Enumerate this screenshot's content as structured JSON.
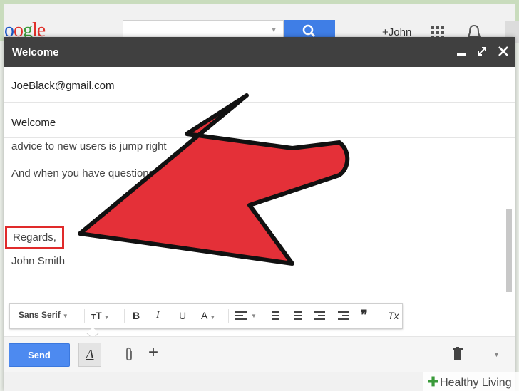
{
  "app": {
    "logo_text": "Google",
    "account": "+John",
    "colors": {
      "header": "#404040",
      "send": "#4d8af0",
      "search": "#3f7ee6",
      "arrow": "#e43038",
      "highlight": "#e02a2a"
    }
  },
  "compose": {
    "title": "Welcome",
    "to": "JoeBlack@gmail.com",
    "subject": "Welcome",
    "body": {
      "line1": "advice to new users is jump right",
      "line2": "And when you have questions",
      "regards": "Regards,",
      "signature": "John Smith"
    },
    "header_icons": [
      "minimize-icon",
      "popout-icon",
      "close-icon"
    ]
  },
  "formatting": {
    "font": "Sans Serif",
    "icons": [
      "text-size-icon",
      "bold-icon",
      "italic-icon",
      "underline-icon",
      "text-color-icon",
      "align-icon",
      "numbered-list-icon",
      "bulleted-list-icon",
      "indent-less-icon",
      "indent-more-icon",
      "quote-icon",
      "remove-formatting-icon"
    ],
    "bold": "B",
    "italic": "I",
    "underline": "U",
    "text_color": "A",
    "clear": "Tx"
  },
  "toolbar": {
    "send_label": "Send",
    "format_label": "A",
    "plus_label": "+"
  },
  "watermark": "Healthy Living"
}
